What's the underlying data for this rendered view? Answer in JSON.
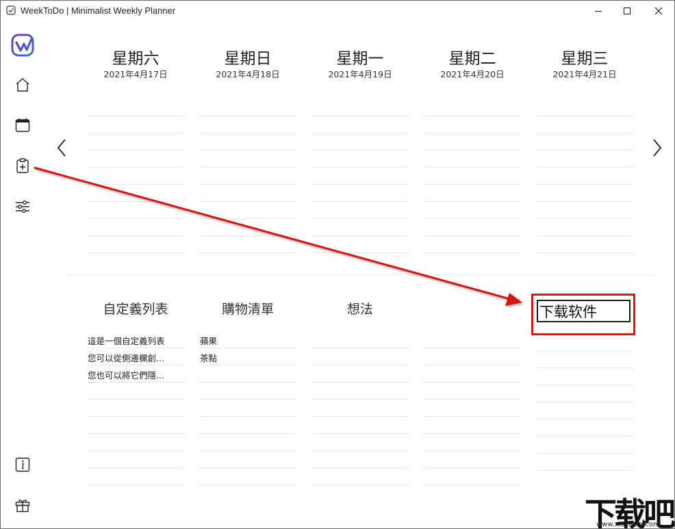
{
  "window": {
    "title": "WeekToDo | Minimalist Weekly Planner",
    "minimize_icon": "minimize-icon",
    "maximize_icon": "maximize-icon",
    "close_icon": "close-icon"
  },
  "sidebar": {
    "logo_icon": "weektodo-logo",
    "items": [
      {
        "icon": "home-icon"
      },
      {
        "icon": "calendar-icon"
      },
      {
        "icon": "custom-list-icon"
      },
      {
        "icon": "settings-sliders-icon"
      },
      {
        "icon": "info-icon"
      },
      {
        "icon": "gift-icon"
      }
    ]
  },
  "week": {
    "days": [
      {
        "name": "星期六",
        "date": "2021年4月17日"
      },
      {
        "name": "星期日",
        "date": "2021年4月18日"
      },
      {
        "name": "星期一",
        "date": "2021年4月19日"
      },
      {
        "name": "星期二",
        "date": "2021年4月20日"
      },
      {
        "name": "星期三",
        "date": "2021年4月21日"
      }
    ],
    "prev_icon": "chevron-left-icon",
    "next_icon": "chevron-right-icon"
  },
  "custom_lists": [
    {
      "title": "自定義列表",
      "items": [
        "這是一個自定義列表",
        "您可以從側邊欄創...",
        "您也可以將它們隱..."
      ]
    },
    {
      "title": "購物清單",
      "items": [
        "蘋果",
        "茶點"
      ]
    },
    {
      "title": "想法",
      "items": []
    }
  ],
  "new_list": {
    "value": "下载软件"
  },
  "watermark": {
    "text": "下载吧",
    "url": "www.xiazaiba.com"
  },
  "colors": {
    "annotation_red": "#d41616",
    "logo_purple": "#6b3fa0",
    "logo_blue": "#3d6bd6"
  }
}
